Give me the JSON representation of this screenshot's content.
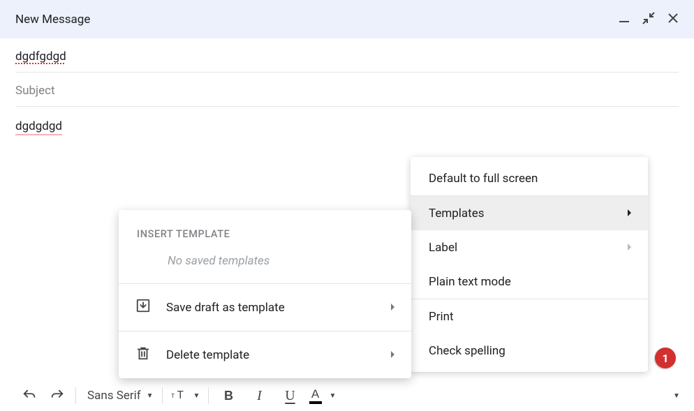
{
  "header": {
    "title": "New Message"
  },
  "compose": {
    "recipients_value": "dgdfgdgd",
    "subject_placeholder": "Subject",
    "body_value": "dgdgdgd"
  },
  "more_menu": {
    "items": [
      {
        "label": "Default to full screen",
        "has_caret": false
      },
      {
        "label": "Templates",
        "has_caret": true,
        "selected": true
      },
      {
        "label": "Label",
        "has_caret": true,
        "dim_caret": true
      },
      {
        "label": "Plain text mode",
        "has_caret": false
      },
      {
        "label": "Print",
        "has_caret": false
      },
      {
        "label": "Check spelling",
        "has_caret": false
      }
    ]
  },
  "templates_submenu": {
    "header": "INSERT TEMPLATE",
    "empty_text": "No saved templates",
    "actions": [
      {
        "label": "Save draft as template",
        "icon": "save-draft-icon"
      },
      {
        "label": "Delete template",
        "icon": "trash-icon"
      }
    ]
  },
  "toolbar": {
    "font_name": "Sans Serif",
    "bold_glyph": "B",
    "italic_glyph": "I",
    "underline_glyph": "U",
    "textcolor_glyph": "A"
  },
  "badge": {
    "count": "1"
  }
}
